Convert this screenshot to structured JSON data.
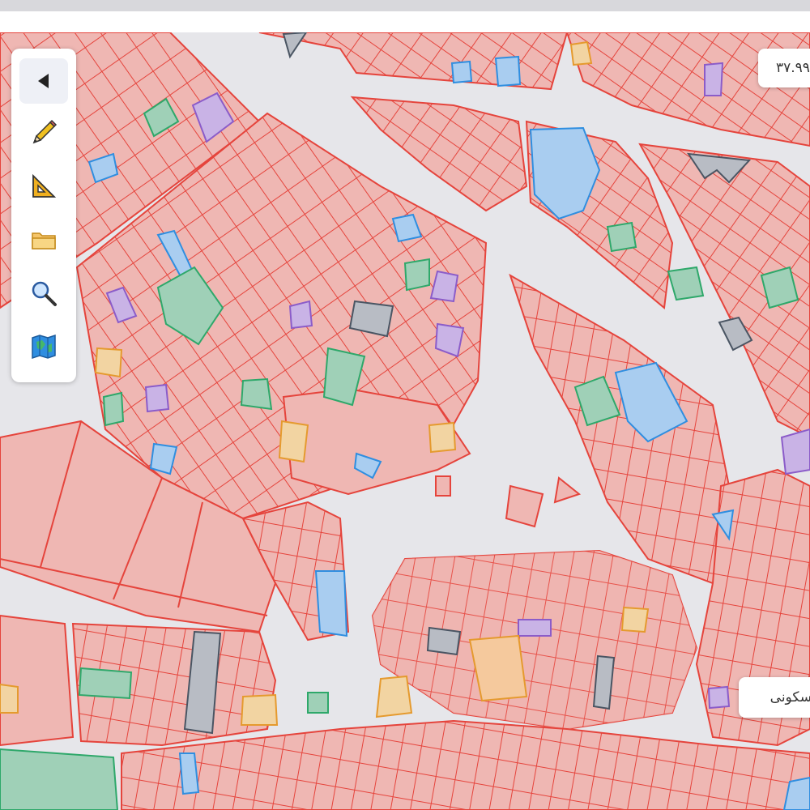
{
  "toolbar": {
    "tools": [
      {
        "name": "back-arrow-icon",
        "active": true
      },
      {
        "name": "pencil-icon",
        "active": false
      },
      {
        "name": "set-square-icon",
        "active": false
      },
      {
        "name": "folder-icon",
        "active": false
      },
      {
        "name": "magnifier-icon",
        "active": false
      },
      {
        "name": "map-book-icon",
        "active": false
      }
    ]
  },
  "coordinate_readout": "۳۷.۹۹",
  "landuse_label": "مسکونی",
  "colors": {
    "background": "#e6e6ea",
    "road": "#e6e6ea",
    "parcel_residential_fill": "#efb7b3",
    "parcel_outline": "#e5443c",
    "commercial_fill": "#9fd0b7",
    "commercial_outline": "#2ea86a",
    "administrative_fill": "#c9b3e6",
    "administrative_outline": "#8b5cc9",
    "public_fill": "#a9cdf0",
    "public_outline": "#2f8ee0",
    "educational_fill": "#f2d4a2",
    "educational_outline": "#e59a2e",
    "vacant_fill": "#b8bcc4",
    "vacant_outline": "#4a5563"
  }
}
